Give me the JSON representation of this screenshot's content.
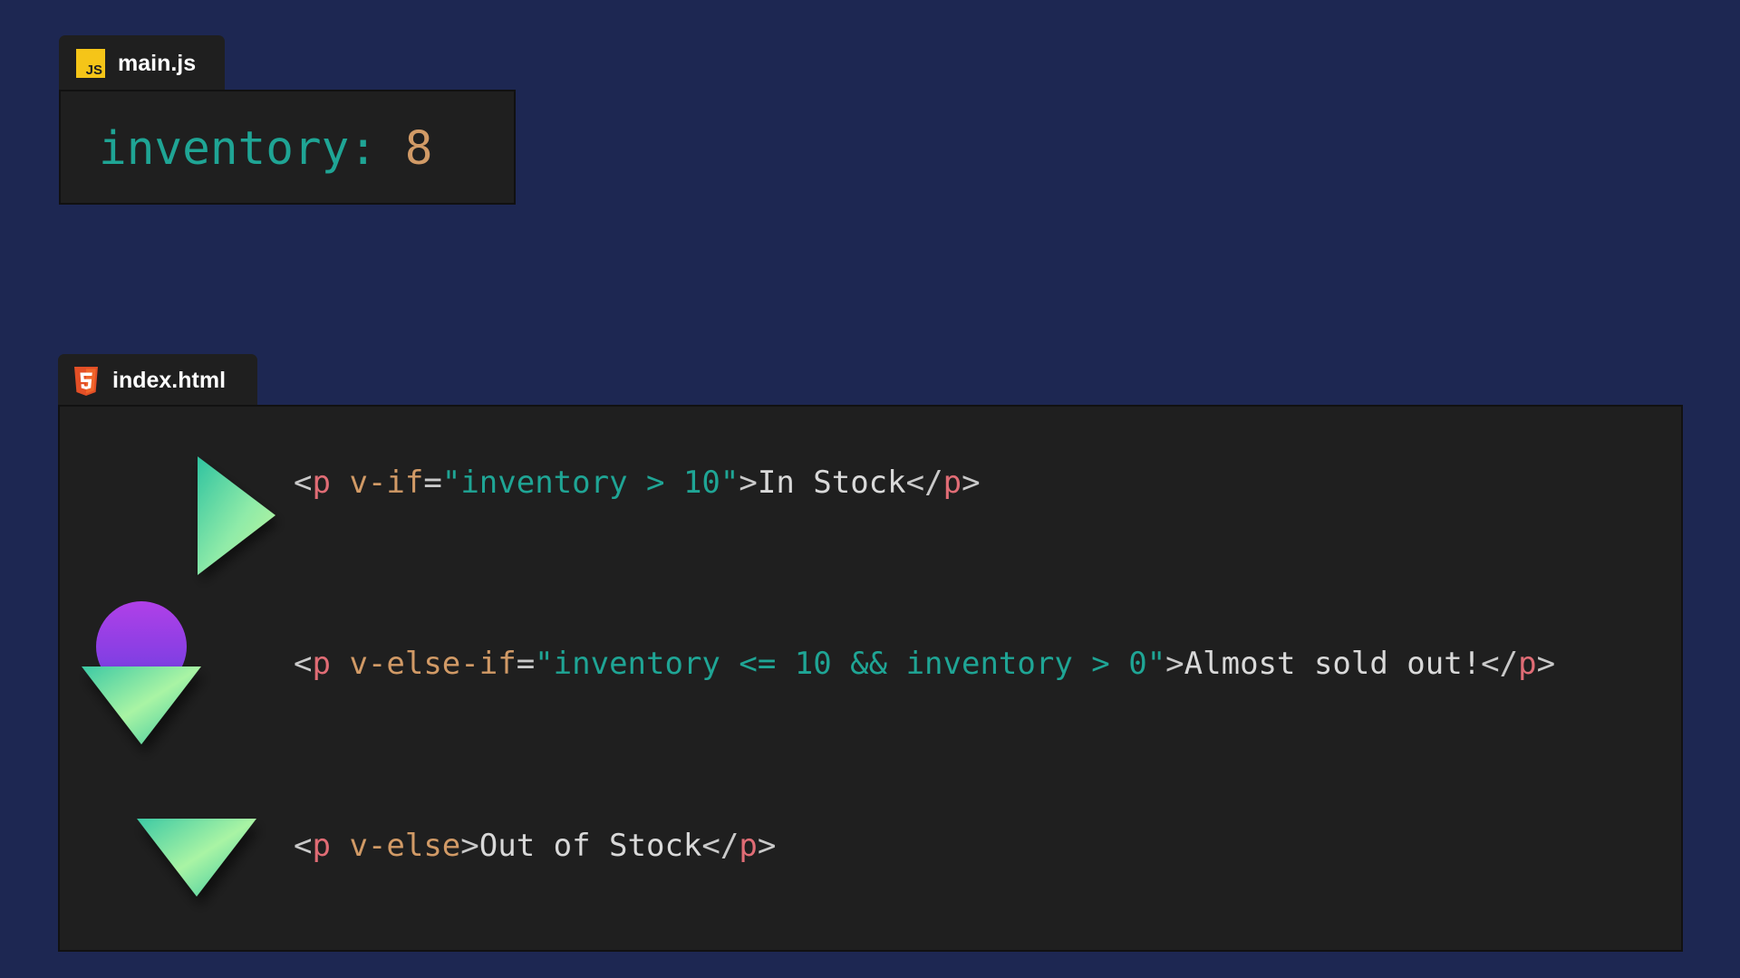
{
  "tabs": {
    "js": {
      "icon": "js-icon",
      "icon_text": "JS",
      "label": "main.js",
      "color": "#f5c518"
    },
    "html": {
      "icon": "html5-icon",
      "label": "index.html",
      "color": "#e34f26"
    }
  },
  "js_panel": {
    "key": "inventory",
    "colon": ":",
    "value": "8"
  },
  "html_panel": {
    "lines": [
      {
        "indicator": "play-triangle-icon",
        "lt": "<",
        "tag": "p",
        "attr": "v-if",
        "eq": "=",
        "quote_open": "\"",
        "condition": "inventory > 10",
        "quote_close": "\"",
        "gt": ">",
        "text": "In Stock",
        "close_lt": "</",
        "close_tag": "p",
        "close_gt": ">"
      },
      {
        "indicator": "orb-down-triangle-icon",
        "lt": "<",
        "tag": "p",
        "attr": "v-else-if",
        "eq": "=",
        "quote_open": "\"",
        "condition": "inventory <= 10 && inventory > 0",
        "quote_close": "\"",
        "gt": ">",
        "text": "Almost sold out!",
        "close_lt": "</",
        "close_tag": "p",
        "close_gt": ">"
      },
      {
        "indicator": "down-triangle-icon",
        "lt": "<",
        "tag": "p",
        "attr": "v-else",
        "gt": ">",
        "text": "Out of Stock",
        "close_lt": "</",
        "close_tag": "p",
        "close_gt": ">"
      }
    ]
  },
  "colors": {
    "background": "#1d2752",
    "panel": "#1f1f1f",
    "string": "#1fa595",
    "attribute": "#d19a66",
    "tag": "#e06c75",
    "text": "#d9d9d9",
    "gradient_green_light": "#b3f5a0",
    "gradient_teal": "#2fc3a0",
    "orb_purple": "#8a3ee8"
  }
}
